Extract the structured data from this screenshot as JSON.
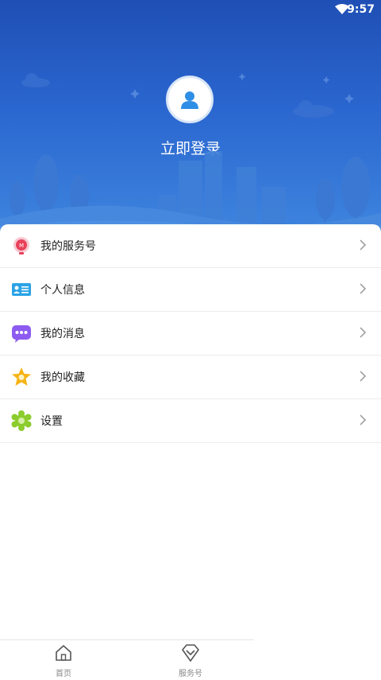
{
  "status": {
    "time": "9:57",
    "wifi_icon": "wifi-icon"
  },
  "header": {
    "login_label": "立即登录",
    "avatar_icon": "user-avatar-icon"
  },
  "menu": [
    {
      "label": "我的服务号",
      "icon": "service-account-icon",
      "color": "#e8405a"
    },
    {
      "label": "个人信息",
      "icon": "id-card-icon",
      "color": "#2aa3e6"
    },
    {
      "label": "我的消息",
      "icon": "message-icon",
      "color": "#8d5bf0"
    },
    {
      "label": "我的收藏",
      "icon": "star-icon",
      "color": "#f5b315"
    },
    {
      "label": "设置",
      "icon": "gear-icon",
      "color": "#8ccc2e"
    }
  ],
  "tabbar": [
    {
      "label": "首页",
      "icon": "home-icon"
    },
    {
      "label": "服务号",
      "icon": "diamond-icon"
    }
  ]
}
